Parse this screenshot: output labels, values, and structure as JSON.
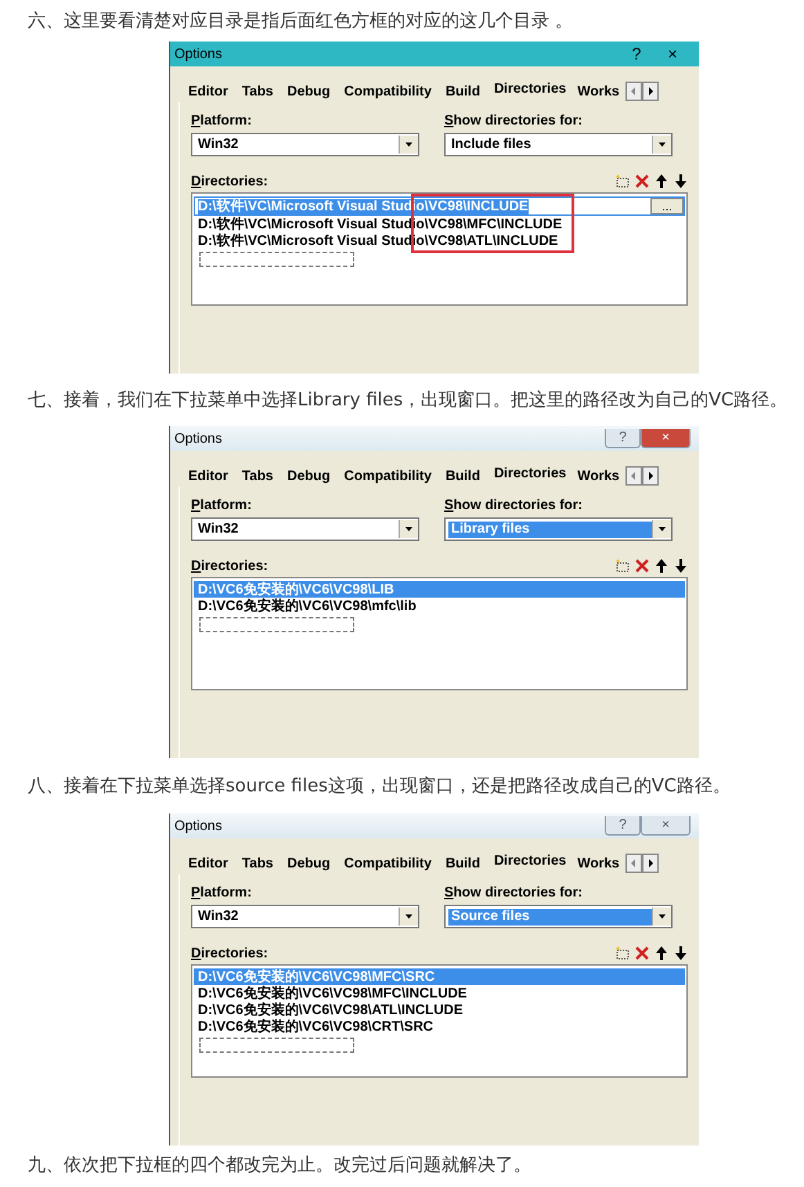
{
  "sections": [
    {
      "text": "六、这里要看清楚对应目录是指后面红色方框的对应的这几个目录 。",
      "dialog": {
        "title": "Options",
        "teal_title": true,
        "title_buttons": [
          "?",
          "×"
        ],
        "tabs": [
          {
            "label": "Editor",
            "selected": false
          },
          {
            "label": "Tabs",
            "selected": false
          },
          {
            "label": "Debug",
            "selected": false
          },
          {
            "label": "Compatibility",
            "selected": false
          },
          {
            "label": "Build",
            "selected": false
          },
          {
            "label": "Directories",
            "selected": true
          },
          {
            "label": "Works",
            "selected": false
          }
        ],
        "platform_label": "Platform:",
        "platform": "Win32",
        "show_label": "Show directories for:",
        "show_value": "Include files",
        "show_highlighted": false,
        "directories_label": "Directories:",
        "browse_button": "...",
        "highlight_box": true,
        "rows": [
          {
            "path": "D:\\软件\\VC\\Microsoft Visual Studio\\VC98\\INCLUDE",
            "selected": true,
            "editing": true
          },
          {
            "path": "D:\\软件\\VC\\Microsoft Visual Studio\\VC98\\MFC\\INCLUDE",
            "selected": false,
            "editing": false
          },
          {
            "path": "D:\\软件\\VC\\Microsoft Visual Studio\\VC98\\ATL\\INCLUDE",
            "selected": false,
            "editing": false
          }
        ]
      }
    },
    {
      "text": "七、接着，我们在下拉菜单中选择Library files，出现窗口。把这里的路径改为自己的VC路径。",
      "dialog": {
        "title": "Options",
        "teal_title": false,
        "title_buttons": [
          "?",
          "×"
        ],
        "close_hover": true,
        "tabs": [
          {
            "label": "Editor",
            "selected": false
          },
          {
            "label": "Tabs",
            "selected": false
          },
          {
            "label": "Debug",
            "selected": false
          },
          {
            "label": "Compatibility",
            "selected": false
          },
          {
            "label": "Build",
            "selected": false
          },
          {
            "label": "Directories",
            "selected": true
          },
          {
            "label": "Works",
            "selected": false
          }
        ],
        "platform_label": "Platform:",
        "platform": "Win32",
        "show_label": "Show directories for:",
        "show_value": "Library files",
        "show_highlighted": true,
        "directories_label": "Directories:",
        "rows": [
          {
            "path": "D:\\VC6免安装的\\VC6\\VC98\\LIB",
            "selected": true,
            "editing": false
          },
          {
            "path": "D:\\VC6免安装的\\VC6\\VC98\\mfc\\lib",
            "selected": false,
            "editing": false
          }
        ]
      }
    },
    {
      "text": "八、接着在下拉菜单选择source files这项，出现窗口，还是把路径改成自己的VC路径。",
      "dialog": {
        "title": "Options",
        "teal_title": false,
        "title_buttons": [
          "?",
          "×"
        ],
        "close_hover": false,
        "tabs": [
          {
            "label": "Editor",
            "selected": false
          },
          {
            "label": "Tabs",
            "selected": false
          },
          {
            "label": "Debug",
            "selected": false
          },
          {
            "label": "Compatibility",
            "selected": false
          },
          {
            "label": "Build",
            "selected": false
          },
          {
            "label": "Directories",
            "selected": true
          },
          {
            "label": "Works",
            "selected": false
          }
        ],
        "platform_label": "Platform:",
        "platform": "Win32",
        "show_label": "Show directories for:",
        "show_value": "Source files",
        "show_highlighted": true,
        "directories_label": "Directories:",
        "rows": [
          {
            "path": "D:\\VC6免安装的\\VC6\\VC98\\MFC\\SRC",
            "selected": true,
            "editing": false
          },
          {
            "path": "D:\\VC6免安装的\\VC6\\VC98\\MFC\\INCLUDE",
            "selected": false,
            "editing": false
          },
          {
            "path": "D:\\VC6免安装的\\VC6\\VC98\\ATL\\INCLUDE",
            "selected": false,
            "editing": false
          },
          {
            "path": "D:\\VC6免安装的\\VC6\\VC98\\CRT\\SRC",
            "selected": false,
            "editing": false
          }
        ]
      }
    }
  ],
  "closing": "九、依次把下拉框的四个都改完为止。改完过后问题就解决了。"
}
